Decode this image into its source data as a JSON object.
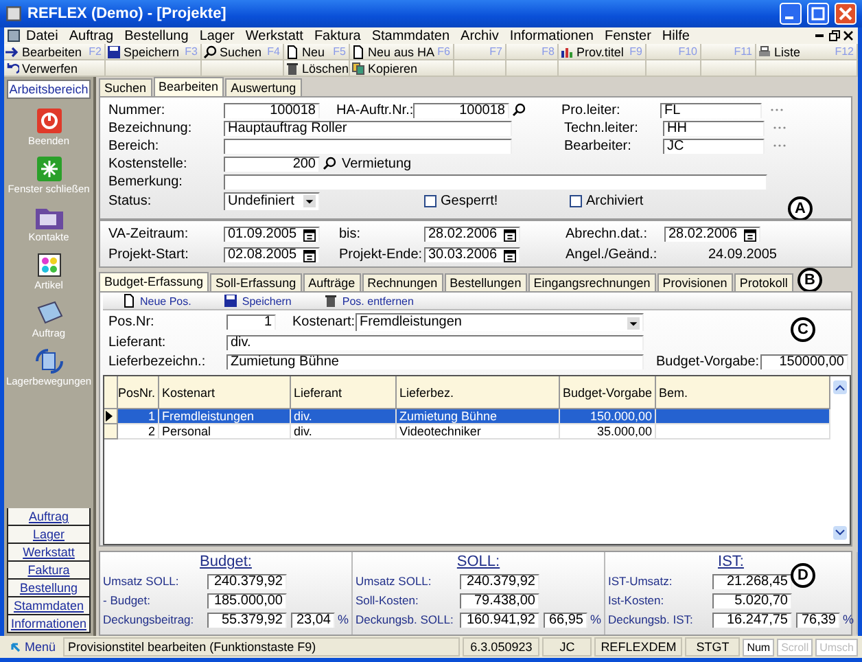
{
  "window": {
    "title": "REFLEX (Demo) - [Projekte]"
  },
  "menu": [
    "Datei",
    "Auftrag",
    "Bestellung",
    "Lager",
    "Werkstatt",
    "Faktura",
    "Stammdaten",
    "Archiv",
    "Informationen",
    "Fenster",
    "Hilfe"
  ],
  "toolbar": [
    {
      "label": "Bearbeiten",
      "key": "F2",
      "second_label": "Verwerfen"
    },
    {
      "label": "Speichern",
      "key": "F3"
    },
    {
      "label": "Suchen",
      "key": "F4"
    },
    {
      "label": "Neu",
      "key": "F5",
      "second_label": "Löschen"
    },
    {
      "label": "Neu aus HA",
      "key": "F6",
      "second_label": "Kopieren"
    },
    {
      "key": "F7"
    },
    {
      "key": "F8"
    },
    {
      "label": "Prov.titel",
      "key": "F9"
    },
    {
      "key": "F10"
    },
    {
      "key": "F11"
    },
    {
      "label": "Liste",
      "key": "F12"
    }
  ],
  "sidebar": {
    "header": "Arbeitsbereich",
    "items": [
      "Beenden",
      "Fenster schließen",
      "Kontakte",
      "Artikel",
      "Auftrag",
      "Lagerbewegungen"
    ],
    "groups": [
      "Auftrag",
      "Lager",
      "Werkstatt",
      "Faktura",
      "Bestellung",
      "Stammdaten",
      "Informationen"
    ]
  },
  "view_tabs": [
    {
      "label": "Suchen",
      "selected": false
    },
    {
      "label": "Bearbeiten",
      "selected": true
    },
    {
      "label": "Auswertung",
      "selected": false
    }
  ],
  "project": {
    "nummer": {
      "label": "Nummer:",
      "value": "100018"
    },
    "ha_auftr_nr": {
      "label": "HA-Auftr.Nr.:",
      "value": "100018"
    },
    "bezeichnung": {
      "label": "Bezeichnung:",
      "value": "Hauptauftrag Roller"
    },
    "bereich": {
      "label": "Bereich:"
    },
    "kostenstelle": {
      "label": "Kostenstelle:",
      "value": "200",
      "name": "Vermietung"
    },
    "bemerkung": {
      "label": "Bemerkung:"
    },
    "status": {
      "label": "Status:",
      "value": "Undefiniert"
    },
    "gesperrt": {
      "label": "Gesperrt!",
      "checked": false
    },
    "archiviert": {
      "label": "Archiviert",
      "checked": false
    },
    "people": [
      {
        "label": "Pro.leiter:",
        "value": "FL"
      },
      {
        "label": "Techn.leiter:",
        "value": "HH"
      },
      {
        "label": "Bearbeiter:",
        "value": "JC"
      }
    ],
    "va_zeitraum": {
      "label": "VA-Zeitraum:",
      "value": "01.09.2005"
    },
    "bis": {
      "label": "bis:",
      "value": "28.02.2006"
    },
    "abrechn_dat": {
      "label": "Abrechn.dat.:",
      "value": "28.02.2006"
    },
    "projekt_start": {
      "label": "Projekt-Start:",
      "value": "02.08.2005"
    },
    "projekt_ende": {
      "label": "Projekt-Ende:",
      "value": "30.03.2006"
    },
    "angel_geaend": {
      "label": "Angel./Geänd.:",
      "value": "24.09.2005"
    }
  },
  "markers": [
    "A",
    "B",
    "C",
    "D"
  ],
  "detail_tabs": [
    {
      "label": "Budget-Erfassung",
      "selected": true
    },
    {
      "label": "Soll-Erfassung",
      "selected": false
    },
    {
      "label": "Aufträge",
      "selected": false
    },
    {
      "label": "Rechnungen",
      "selected": false
    },
    {
      "label": "Bestellungen",
      "selected": false
    },
    {
      "label": "Eingangsrechnungen",
      "selected": false
    },
    {
      "label": "Provisionen",
      "selected": false
    },
    {
      "label": "Protokoll",
      "selected": false
    }
  ],
  "detail_toolbar": [
    "Neue Pos.",
    "Speichern",
    "Pos. entfernen"
  ],
  "position": {
    "pos_nr": {
      "label": "Pos.Nr:",
      "value": "1"
    },
    "kostenart": {
      "label": "Kostenart:",
      "value": "Fremdleistungen"
    },
    "lieferant": {
      "label": "Lieferant:",
      "value": "div."
    },
    "lieferbezeichn": {
      "label": "Lieferbezeichn.:",
      "value": "Zumietung Bühne"
    },
    "budget_vorgabe": {
      "label": "Budget-Vorgabe:",
      "value": "150000,00"
    }
  },
  "table": {
    "columns": [
      "PosNr.",
      "Kostenart",
      "Lieferant",
      "Lieferbez.",
      "Budget-Vorgabe",
      "Bem."
    ],
    "rows": [
      {
        "cells": [
          "1",
          "Fremdleistungen",
          "div.",
          "Zumietung Bühne",
          "150.000,00"
        ],
        "selected": true
      },
      {
        "cells": [
          "2",
          "Personal",
          "div.",
          "Videotechniker",
          "35.000,00"
        ],
        "selected": false
      }
    ]
  },
  "summary": [
    {
      "title": "Budget:",
      "rows": [
        {
          "label": "Umsatz SOLL:",
          "value": "240.379,92"
        },
        {
          "label": "- Budget:",
          "value": "185.000,00"
        },
        {
          "label": "Deckungsbeitrag:",
          "value": "55.379,92",
          "percent": "23,04",
          "unit": "%"
        }
      ]
    },
    {
      "title": "SOLL:",
      "rows": [
        {
          "label": "Umsatz SOLL:",
          "value": "240.379,92"
        },
        {
          "label": "Soll-Kosten:",
          "value": "79.438,00"
        },
        {
          "label": "Deckungsb. SOLL:",
          "value": "160.941,92",
          "percent": "66,95",
          "unit": "%"
        }
      ]
    },
    {
      "title": "IST:",
      "rows": [
        {
          "label": "IST-Umsatz:",
          "value": "21.268,45"
        },
        {
          "label": "Ist-Kosten:",
          "value": "5.020,70"
        },
        {
          "label": "Deckungsb. IST:",
          "value": "16.247,75",
          "percent": "76,39",
          "unit": "%"
        }
      ]
    }
  ],
  "status_bar": {
    "menu_button": "Menü",
    "message": "Provisionstitel bearbeiten (Funktionstaste F9)",
    "panels": [
      "6.3.050923",
      "JC",
      "REFLEXDEM",
      "STGT"
    ],
    "indicators": [
      {
        "label": "Num",
        "on": true
      },
      {
        "label": "Scroll",
        "on": false
      },
      {
        "label": "Umsch",
        "on": false
      }
    ]
  }
}
